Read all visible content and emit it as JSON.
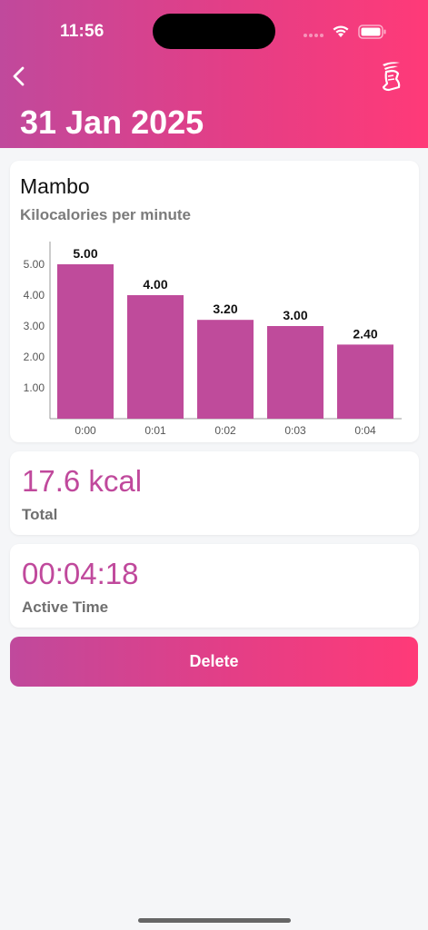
{
  "status_bar": {
    "time": "11:56"
  },
  "header": {
    "title": "31 Jan 2025"
  },
  "chart_card": {
    "title": "Mambo",
    "subtitle": "Kilocalories per minute"
  },
  "chart_data": {
    "type": "bar",
    "title": "Mambo",
    "subtitle": "Kilocalories per minute",
    "categories": [
      "0:00",
      "0:01",
      "0:02",
      "0:03",
      "0:04"
    ],
    "values": [
      5.0,
      4.0,
      3.2,
      3.0,
      2.4
    ],
    "value_labels": [
      "5.00",
      "4.00",
      "3.20",
      "3.00",
      "2.40"
    ],
    "y_ticks": [
      "1.00",
      "2.00",
      "3.00",
      "4.00",
      "5.00"
    ],
    "ylim": [
      0,
      5.0
    ],
    "grid": false,
    "bar_color": "#bf4b9b"
  },
  "total": {
    "value": "17.6 kcal",
    "label": "Total"
  },
  "active_time": {
    "value": "00:04:18",
    "label": "Active Time"
  },
  "actions": {
    "delete_label": "Delete"
  },
  "colors": {
    "accent": "#c0499c",
    "accent_end": "#ff3a78"
  }
}
